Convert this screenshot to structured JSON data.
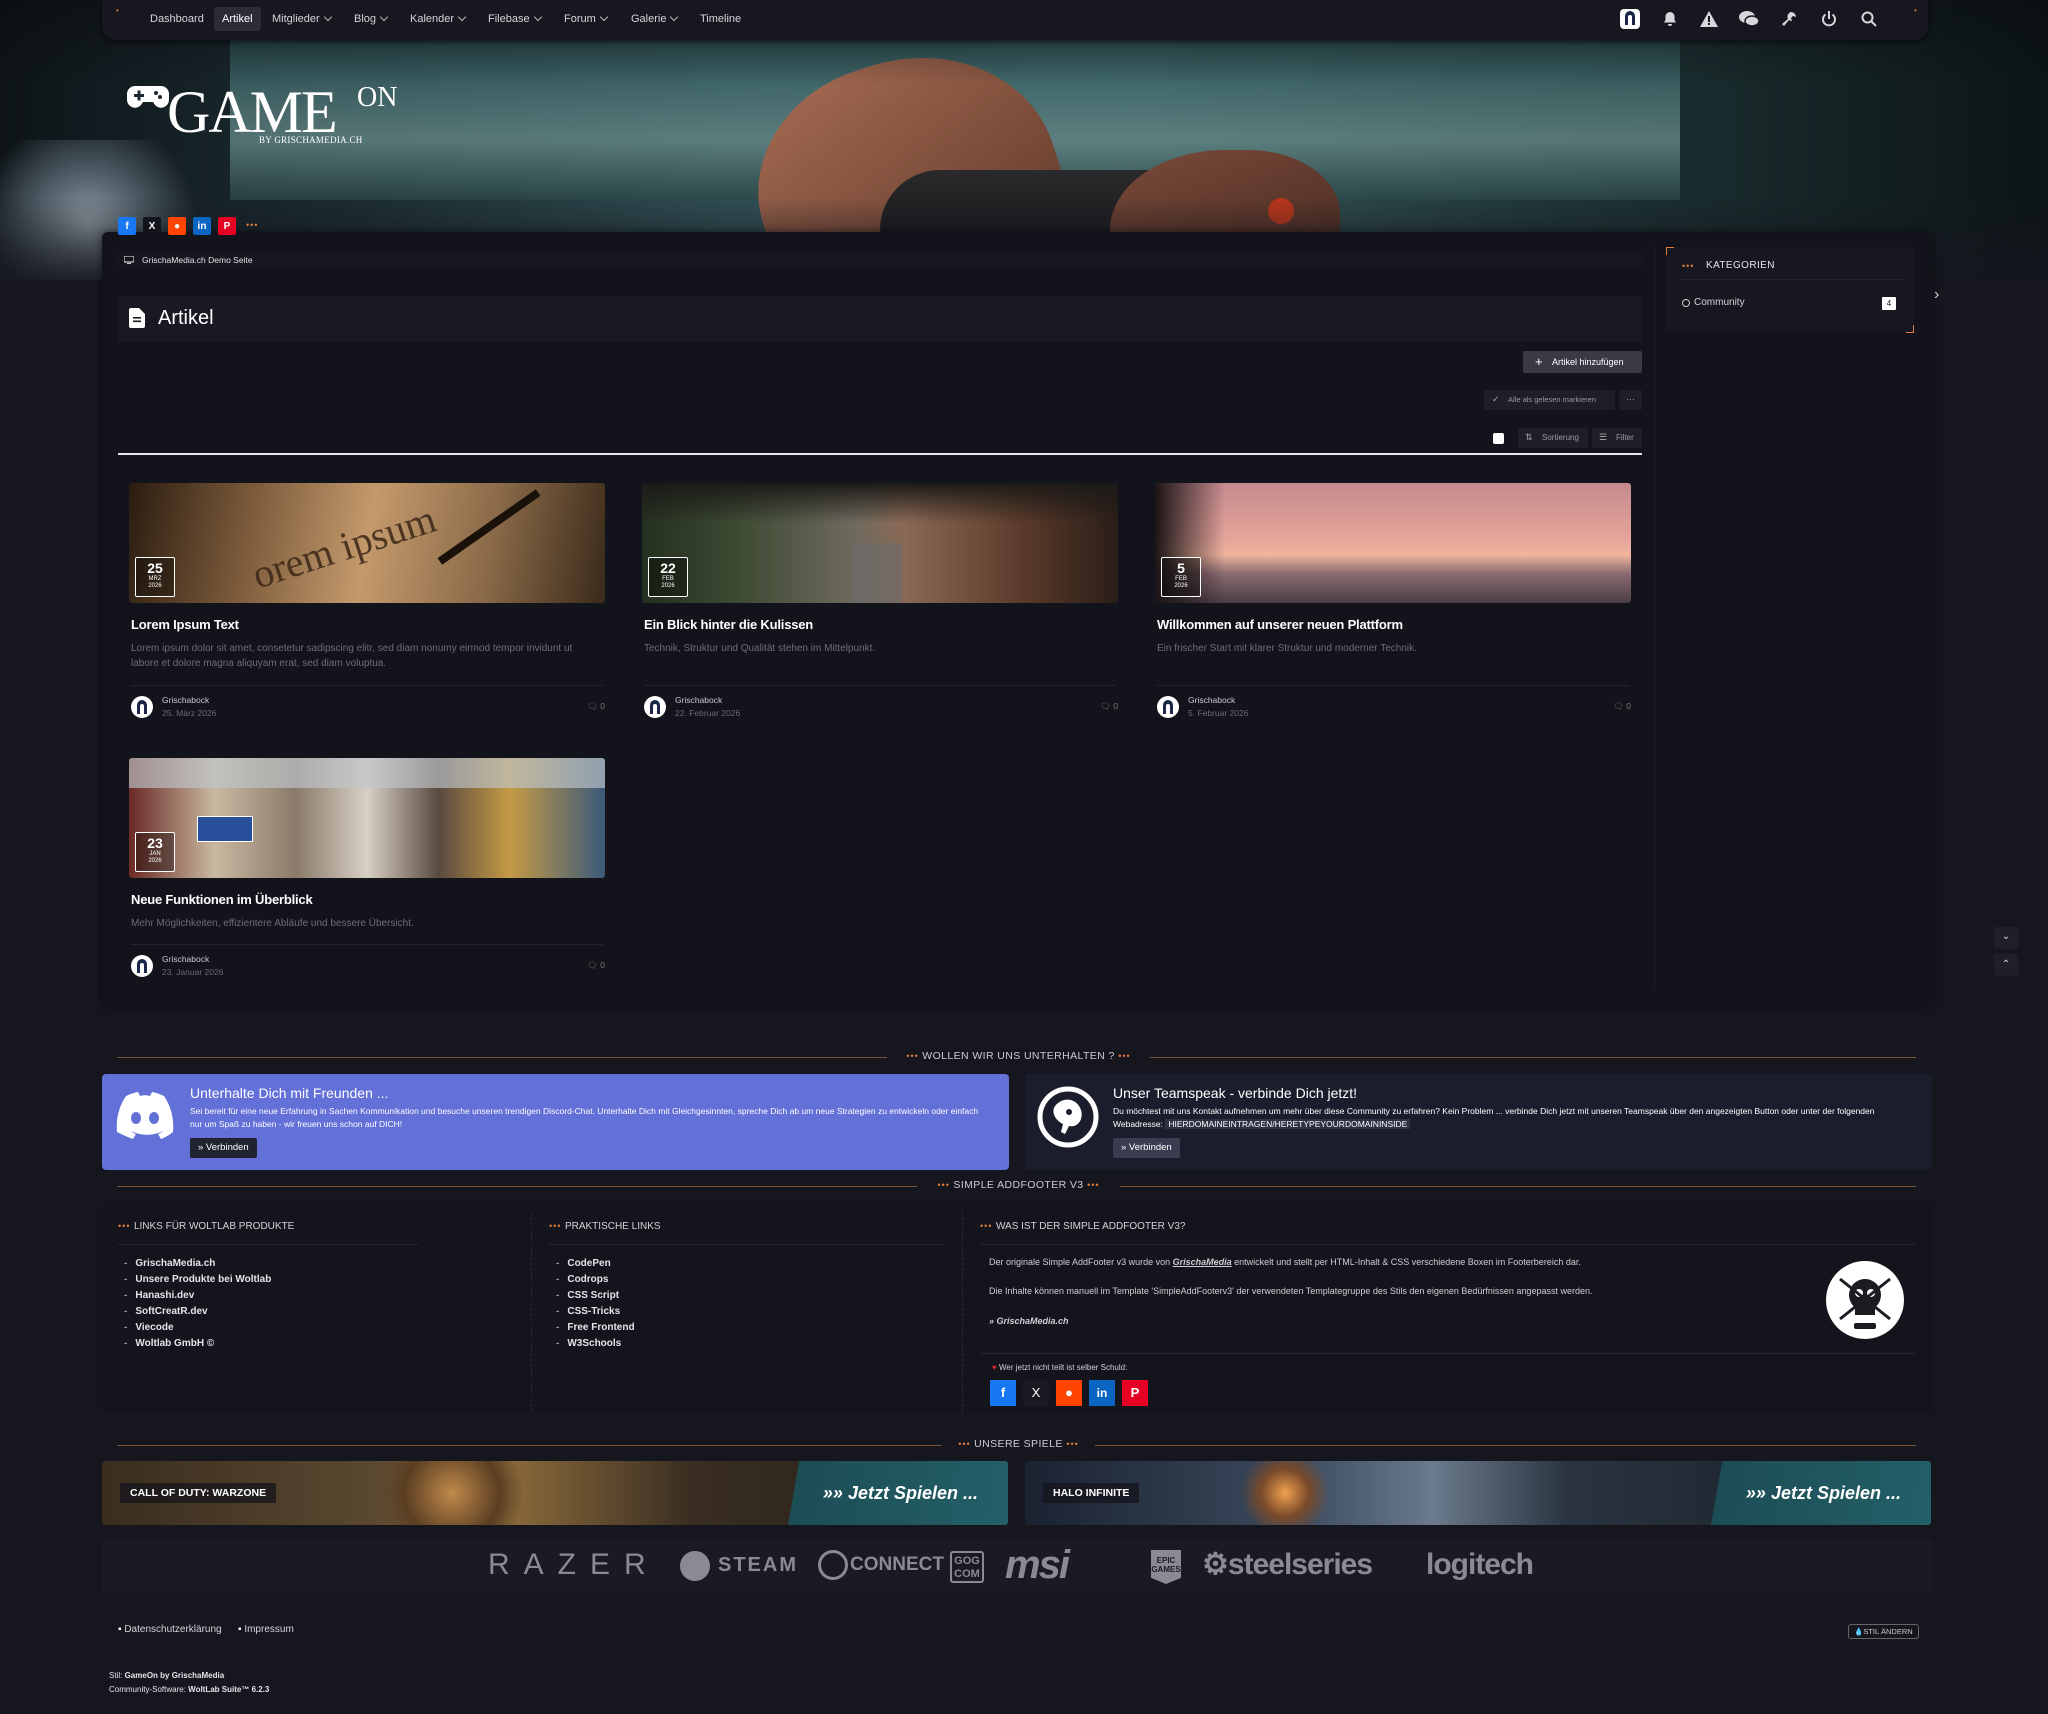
{
  "nav": {
    "items": [
      {
        "label": "Dashboard",
        "dropdown": false,
        "active": false
      },
      {
        "label": "Artikel",
        "dropdown": false,
        "active": true
      },
      {
        "label": "Mitglieder",
        "dropdown": true,
        "active": false
      },
      {
        "label": "Blog",
        "dropdown": true,
        "active": false
      },
      {
        "label": "Kalender",
        "dropdown": true,
        "active": false
      },
      {
        "label": "Filebase",
        "dropdown": true,
        "active": false
      },
      {
        "label": "Forum",
        "dropdown": true,
        "active": false
      },
      {
        "label": "Galerie",
        "dropdown": true,
        "active": false
      },
      {
        "label": "Timeline",
        "dropdown": false,
        "active": false
      }
    ],
    "icons": [
      "user-avatar-icon",
      "bell-icon",
      "warning-icon",
      "chat-icon",
      "wrench-icon",
      "power-icon",
      "search-icon"
    ]
  },
  "logo": {
    "main": "GAME",
    "suffix": "ON",
    "byline": "BY GRISCHAMEDIA.CH"
  },
  "breadcrumb": "GrischaMedia.ch Demo Seite",
  "page_title": "Artikel",
  "actions": {
    "add": "Artikel hinzufügen",
    "mark_read": "Alle als gelesen markieren",
    "more": "···",
    "sort": "Sortierung",
    "filter": "Filter"
  },
  "articles": [
    {
      "title": "Lorem Ipsum Text",
      "desc": "Lorem ipsum dolor sit amet, consetetur sadipscing elitr, sed diam nonumy eirmod tempor invidunt ut labore et dolore magna aliquyam erat, sed diam voluptua.",
      "day": "25",
      "month": "MRZ",
      "year": "2026",
      "author": "Grischabock",
      "date": "25. März 2026",
      "comments": "0"
    },
    {
      "title": "Ein Blick hinter die Kulissen",
      "desc": "Technik, Struktur und Qualität stehen im Mittelpunkt.",
      "day": "22",
      "month": "FEB",
      "year": "2026",
      "author": "Grischabock",
      "date": "22. Februar 2026",
      "comments": "0"
    },
    {
      "title": "Willkommen auf unserer neuen Plattform",
      "desc": "Ein frischer Start mit klarer Struktur und moderner Technik.",
      "day": "5",
      "month": "FEB",
      "year": "2026",
      "author": "Grischabock",
      "date": "5. Februar 2026",
      "comments": "0"
    },
    {
      "title": "Neue Funktionen im Überblick",
      "desc": "Mehr Möglichkeiten, effizientere Abläufe und bessere Übersicht.",
      "day": "23",
      "month": "JAN",
      "year": "2026",
      "author": "Grischabock",
      "date": "23. Januar 2026",
      "comments": "0"
    }
  ],
  "sidebar": {
    "title": "KATEGORIEN",
    "items": [
      {
        "label": "Community",
        "count": "4"
      }
    ]
  },
  "contact": {
    "heading": "WOLLEN WIR UNS UNTERHALTEN ?",
    "discord": {
      "title": "Unterhalte Dich mit Freunden ...",
      "text": "Sei bereit für eine neue Erfahrung in Sachen Kommunikation und besuche unseren trendigen Discord-Chat. Unterhalte Dich mit Gleichgesinnten, spreche Dich ab um neue Strategien zu entwickeln oder einfach nur um Spaß zu haben - wir freuen uns schon auf DICH!",
      "button": "» Verbinden"
    },
    "teamspeak": {
      "title": "Unser Teamspeak - verbinde Dich jetzt!",
      "text": "Du möchtest mit uns Kontakt aufnehmen um mehr über diese Community zu erfahren? Kein Problem ... verbinde Dich jetzt mit unseren Teamspeak über den angezeigten Button oder unter der folgenden Webadresse:",
      "address": "HIERDOMAINEINTRAGEN/HERETYPEYOURDOMAININSIDE",
      "button": "» Verbinden"
    }
  },
  "footer": {
    "heading": "SIMPLE ADDFOOTER V3",
    "col1": {
      "title": "LINKS FÜR WOLTLAB PRODUKTE",
      "links": [
        "GrischaMedia.ch",
        "Unsere Produkte bei Woltlab",
        "Hanashi.dev",
        "SoftCreatR.dev",
        "Viecode",
        "Woltlab GmbH ©"
      ]
    },
    "col2": {
      "title": "PRAKTISCHE LINKS",
      "links": [
        "CodePen",
        "Codrops",
        "CSS Script",
        "CSS-Tricks",
        "Free Frontend",
        "W3Schools"
      ]
    },
    "col3": {
      "title": "WAS IST DER SIMPLE ADDFOOTER V3?",
      "p1_pre": "Der originale Simple AddFooter v3 wurde von",
      "p1_brand": "GrischaMedia",
      "p1_post": "entwickelt und stellt per HTML-Inhalt & CSS verschiedene Boxen im Footerbereich dar.",
      "p2": "Die Inhalte können manuell im Template 'SimpleAddFooterv3' der verwendeten Templategruppe des Stils den eigenen Bedürfnissen angepasst werden.",
      "link": "» GrischaMedia.ch",
      "share": "Wer jetzt nicht teilt ist selber Schuld:"
    }
  },
  "games": {
    "heading": "UNSERE SPIELE",
    "items": [
      {
        "name": "CALL OF DUTY: WARZONE",
        "cta": "Jetzt Spielen ..."
      },
      {
        "name": "HALO INFINITE",
        "cta": "Jetzt Spielen ..."
      }
    ]
  },
  "brands": [
    "RAZER",
    "STEAM",
    "CONNECT",
    "GOG COM",
    "msi",
    "EPIC GAMES",
    "steelseries",
    "logitech"
  ],
  "legal": {
    "privacy": "Datenschutzerklärung",
    "imprint": "Impressum",
    "style_change": "STIL ÄNDERN"
  },
  "credits": {
    "style_label": "Stil:",
    "style_value": "GameOn by GrischaMedia",
    "software_label": "Community-Software:",
    "software_value": "WoltLab Suite™ 6.2.3"
  },
  "colors": {
    "background": "#16161f",
    "panel": "#13131b",
    "accent": "#e07b3a",
    "discord": "#6270d7",
    "teamspeak": "#1b1d2c"
  }
}
